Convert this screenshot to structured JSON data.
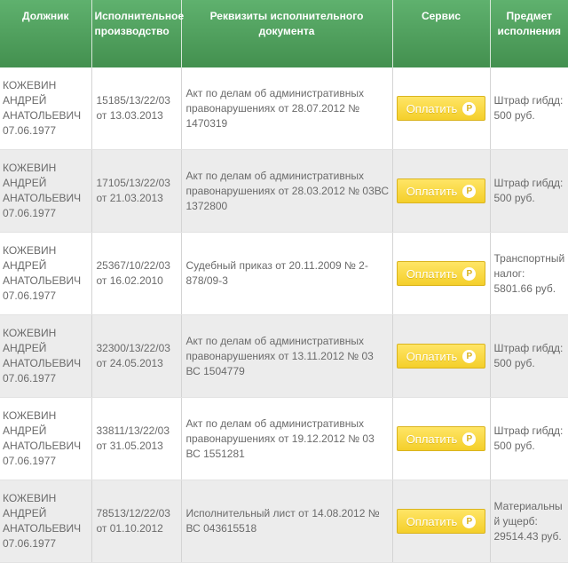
{
  "headers": {
    "debtor": "Должник",
    "proceeding": "Исполнительное производство",
    "requisites": "Реквизиты исполнительного документа",
    "service": "Сервис",
    "subject": "Предмет исполнения"
  },
  "pay_button_label": "Оплатить",
  "ruble_glyph": "Р",
  "colors": {
    "header_green": "#4fa25d",
    "pay_button_yellow": "#f7d737"
  },
  "rows": [
    {
      "debtor_name": "КОЖЕВИН АНДРЕЙ АНАТОЛЬЕВИЧ",
      "debtor_dob": "07.06.1977",
      "proceeding_number": "15185/13/22/03",
      "proceeding_date": "от 13.03.2013",
      "requisites": "Акт по делам об административных правонарушениях от 28.07.2012 № 1470319",
      "subject": "Штраф гибдд: 500 руб."
    },
    {
      "debtor_name": "КОЖЕВИН АНДРЕЙ АНАТОЛЬЕВИЧ",
      "debtor_dob": "07.06.1977",
      "proceeding_number": "17105/13/22/03",
      "proceeding_date": "от 21.03.2013",
      "requisites": "Акт по делам об административных правонарушениях от 28.03.2012 № 03ВС 1372800",
      "subject": "Штраф гибдд: 500 руб."
    },
    {
      "debtor_name": "КОЖЕВИН АНДРЕЙ АНАТОЛЬЕВИЧ",
      "debtor_dob": "07.06.1977",
      "proceeding_number": "25367/10/22/03",
      "proceeding_date": "от 16.02.2010",
      "requisites": "Судебный приказ от 20.11.2009 № 2-878/09-3",
      "subject": "Транспортный налог: 5801.66 руб."
    },
    {
      "debtor_name": "КОЖЕВИН АНДРЕЙ АНАТОЛЬЕВИЧ",
      "debtor_dob": "07.06.1977",
      "proceeding_number": "32300/13/22/03",
      "proceeding_date": "от 24.05.2013",
      "requisites": "Акт по делам об административных правонарушениях от 13.11.2012 № 03 ВС 1504779",
      "subject": "Штраф гибдд: 500 руб."
    },
    {
      "debtor_name": "КОЖЕВИН АНДРЕЙ АНАТОЛЬЕВИЧ",
      "debtor_dob": "07.06.1977",
      "proceeding_number": "33811/13/22/03",
      "proceeding_date": "от 31.05.2013",
      "requisites": "Акт по делам об административных правонарушениях от 19.12.2012 № 03 ВС 1551281",
      "subject": "Штраф гибдд: 500 руб."
    },
    {
      "debtor_name": "КОЖЕВИН АНДРЕЙ АНАТОЛЬЕВИЧ",
      "debtor_dob": "07.06.1977",
      "proceeding_number": "78513/12/22/03",
      "proceeding_date": "от 01.10.2012",
      "requisites": "Исполнительный лист от 14.08.2012 № ВС 043615518",
      "subject": "Материальный ущерб: 29514.43 руб."
    }
  ]
}
